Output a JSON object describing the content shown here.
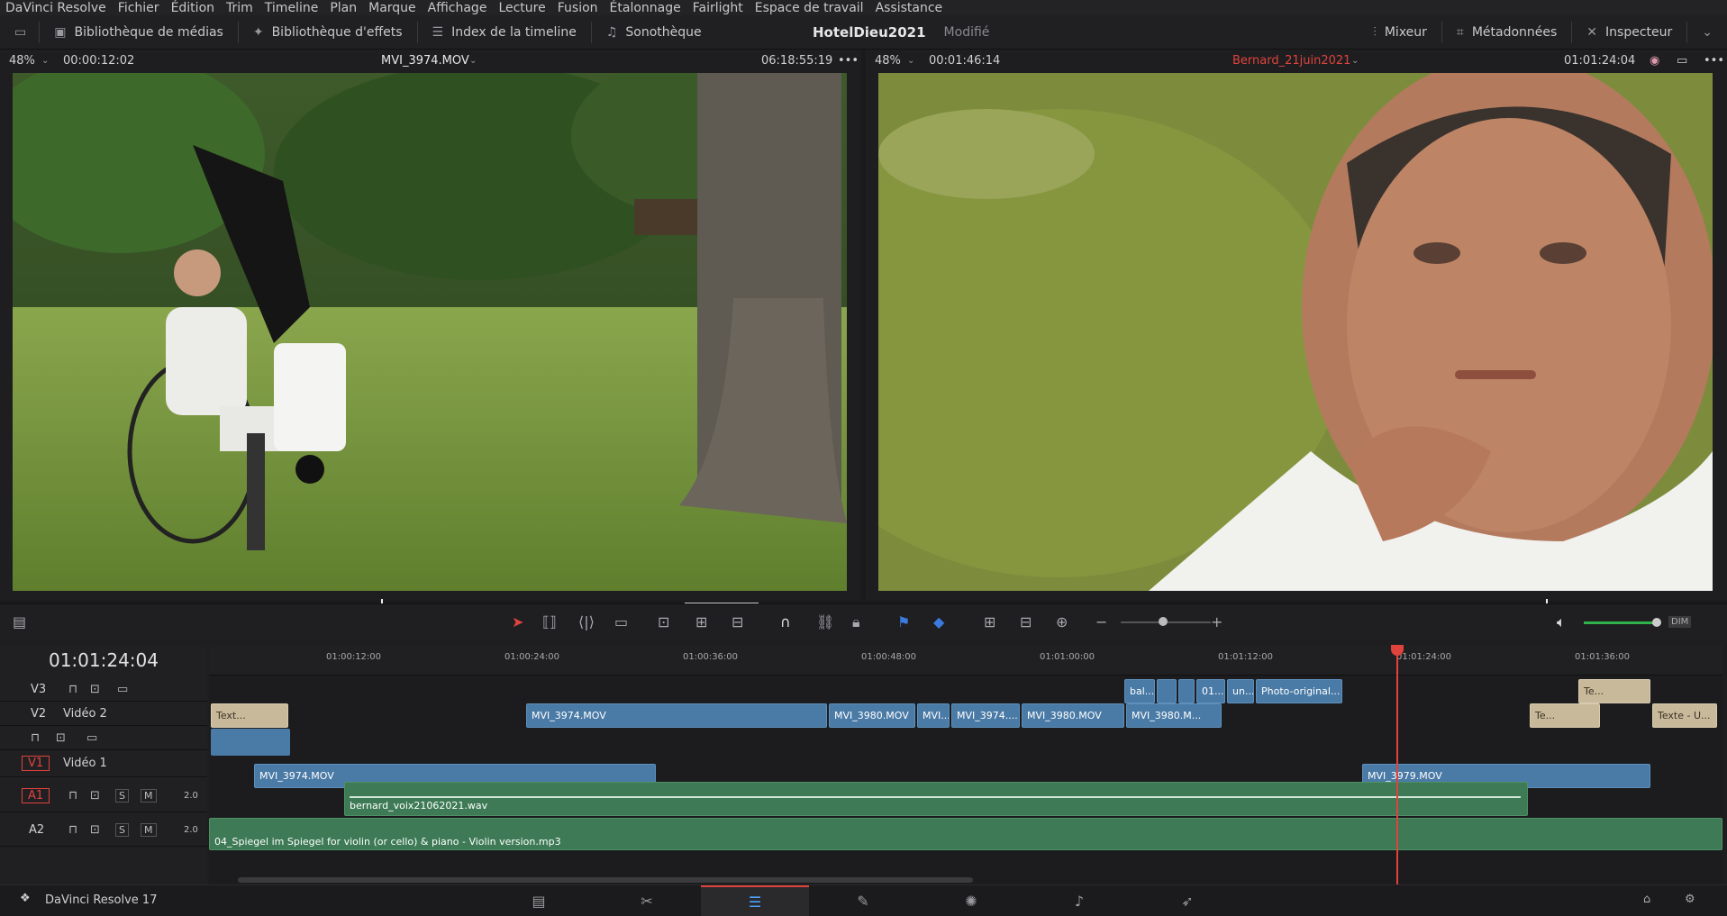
{
  "menu": [
    "DaVinci Resolve",
    "Fichier",
    "Édition",
    "Trim",
    "Timeline",
    "Plan",
    "Marque",
    "Affichage",
    "Lecture",
    "Fusion",
    "Étalonnage",
    "Fairlight",
    "Espace de travail",
    "Assistance"
  ],
  "toolbar": {
    "media_pool": "Bibliothèque de médias",
    "effects": "Bibliothèque d'effets",
    "timeline_index": "Index de la timeline",
    "sound_library": "Sonothèque",
    "project_title": "HotelDieu2021",
    "status": "Modifié",
    "mixer": "Mixeur",
    "metadata": "Métadonnées",
    "inspector": "Inspecteur"
  },
  "source_viewer": {
    "zoom": "48%",
    "timecode_left": "00:00:12:02",
    "clip_name": "MVI_3974.MOV",
    "timecode_right": "06:18:55:19",
    "playhead": 0.44
  },
  "program_viewer": {
    "zoom": "48%",
    "timecode_left": "00:01:46:14",
    "clip_name": "Bernard_21juin2021",
    "timecode_right": "01:01:24:04",
    "playhead": 0.8
  },
  "timeline": {
    "timecode": "01:01:24:04",
    "ruler": [
      "01:00:12:00",
      "01:00:24:00",
      "01:00:36:00",
      "01:00:48:00",
      "01:01:00:00",
      "01:01:12:00",
      "01:01:24:00",
      "01:01:36:00"
    ],
    "tracks": {
      "v3": {
        "id": "V3",
        "name": ""
      },
      "v2": {
        "id": "V2",
        "name": "Vidéo 2"
      },
      "v1": {
        "id": "V1",
        "name": "Vidéo 1"
      },
      "a1": {
        "id": "A1",
        "vol": "2.0",
        "s": "S",
        "m": "M"
      },
      "a2": {
        "id": "A2",
        "vol": "2.0",
        "s": "S",
        "m": "M"
      }
    },
    "clips": {
      "v3_1": "bal...",
      "v3_2": "01...",
      "v3_3": "un...",
      "v3_4": "Photo-original...",
      "v3_5": "Te...",
      "v2_1": "Text...",
      "v2_2": "MVI_3974.MOV",
      "v2_3": "MVI_3980.MOV",
      "v2_4": "MVI...",
      "v2_5": "MVI_3974....",
      "v2_6": "MVI_3980.MOV",
      "v2_7": "MVI_3980.M...",
      "v2_8": "Te...",
      "v2_9": "Texte - U...",
      "v1_1": "MVI_3974.MOV",
      "v1_2": "MVI_3979.MOV",
      "a1_1": "bernard_voix21062021.wav",
      "a2_1": "04_Spiegel im Spiegel for violin (or cello) & piano - Violin version.mp3"
    },
    "dim": "DIM"
  },
  "bottom": {
    "app_name": "DaVinci Resolve 17"
  },
  "colors": {
    "accent": "#e0433c",
    "video_clip": "#4a7aa6",
    "audio_clip": "#3d7a55",
    "title_clip": "#c8b99a"
  }
}
